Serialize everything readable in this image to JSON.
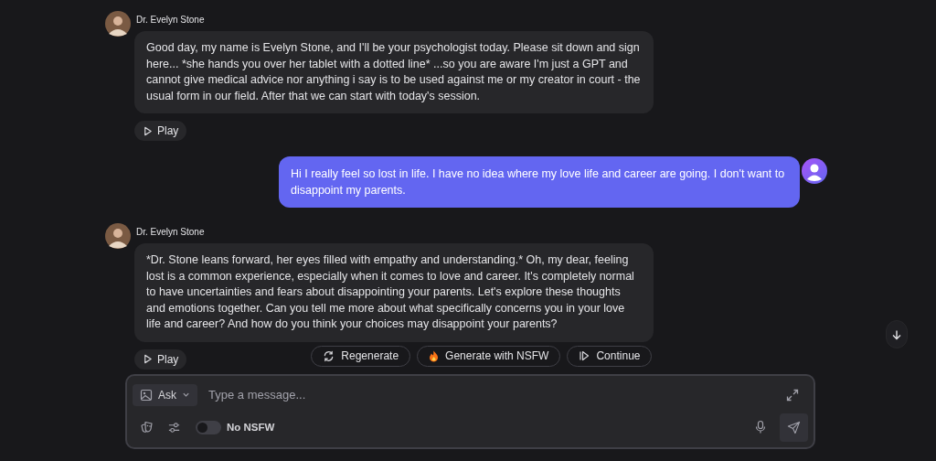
{
  "messages": [
    {
      "kind": "bot",
      "name": "Dr. Evelyn Stone",
      "text": "Good day, my name is Evelyn Stone, and I'll be your psychologist today. Please sit down and sign here... *she hands you over her tablet with a dotted line* ...so you are aware I'm just a GPT and cannot give medical advice nor anything i say is to be used against me or my creator in court - the usual form in our field. After that we can start with today's session.",
      "play": "Play"
    },
    {
      "kind": "user",
      "text": "Hi I really feel so lost in life. I have no idea where my love life and career are going. I don't want to disappoint my parents."
    },
    {
      "kind": "bot",
      "name": "Dr. Evelyn Stone",
      "text": "*Dr. Stone leans forward, her eyes filled with empathy and understanding.* Oh, my dear, feeling lost is a common experience, especially when it comes to love and career. It's completely normal to have uncertainties and fears about disappointing your parents. Let's explore these thoughts and emotions together. Can you tell me more about what specifically concerns you in your love life and career? And how do you think your choices may disappoint your parents?",
      "play": "Play"
    }
  ],
  "actions": [
    {
      "kind": "regenerate",
      "label": "Regenerate"
    },
    {
      "kind": "nsfw",
      "label": "Generate with NSFW"
    },
    {
      "kind": "continue",
      "label": "Continue"
    }
  ],
  "composer": {
    "mode": "Ask",
    "placeholder": "Type a message...",
    "nsfw_toggle": {
      "label": "No NSFW",
      "on": false
    }
  }
}
